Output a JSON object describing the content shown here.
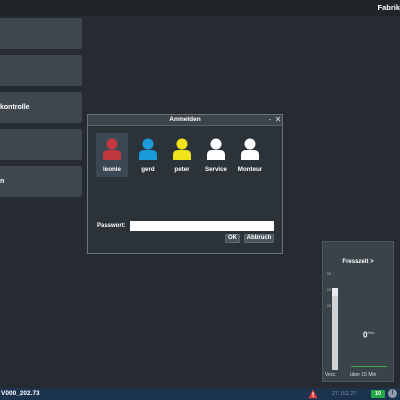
{
  "header": {
    "app_title": "Fabrik"
  },
  "menu": {
    "items": [
      {
        "label": ""
      },
      {
        "label": ""
      },
      {
        "label": "kontrolle"
      },
      {
        "label": ""
      },
      {
        "label": "n"
      }
    ]
  },
  "login_dialog": {
    "title": "Anmelden",
    "minimize_glyph": "-",
    "close_glyph": "✕",
    "users": [
      {
        "name": "leonie",
        "color": "#c0393f",
        "selected": true
      },
      {
        "name": "gerd",
        "color": "#1a9ad8",
        "selected": false
      },
      {
        "name": "peter",
        "color": "#f2e41c",
        "selected": false
      },
      {
        "name": "Service",
        "color": "#ffffff",
        "selected": false
      },
      {
        "name": "Monteur",
        "color": "#ffffff",
        "selected": false
      }
    ],
    "password_label": "Passwort:",
    "password_value": "",
    "ok_label": "OK",
    "cancel_label": "Abbruch"
  },
  "gauge": {
    "title": "Fresszeit >",
    "scale_labels": [
      "30",
      "25",
      "20"
    ],
    "value": "0",
    "unit": "Min.",
    "left_label": "Verz.",
    "right_label": "über 15 Min",
    "fill_color": "#cfd3d6",
    "indicator_color": "#3aa84a"
  },
  "statusbar": {
    "version": "V000_202.73",
    "warning_icon": "warning-triangle-icon",
    "ip_text": "27.152.27",
    "connection_badge": "10",
    "info_icon": "info-icon",
    "background": "#1c3350"
  }
}
